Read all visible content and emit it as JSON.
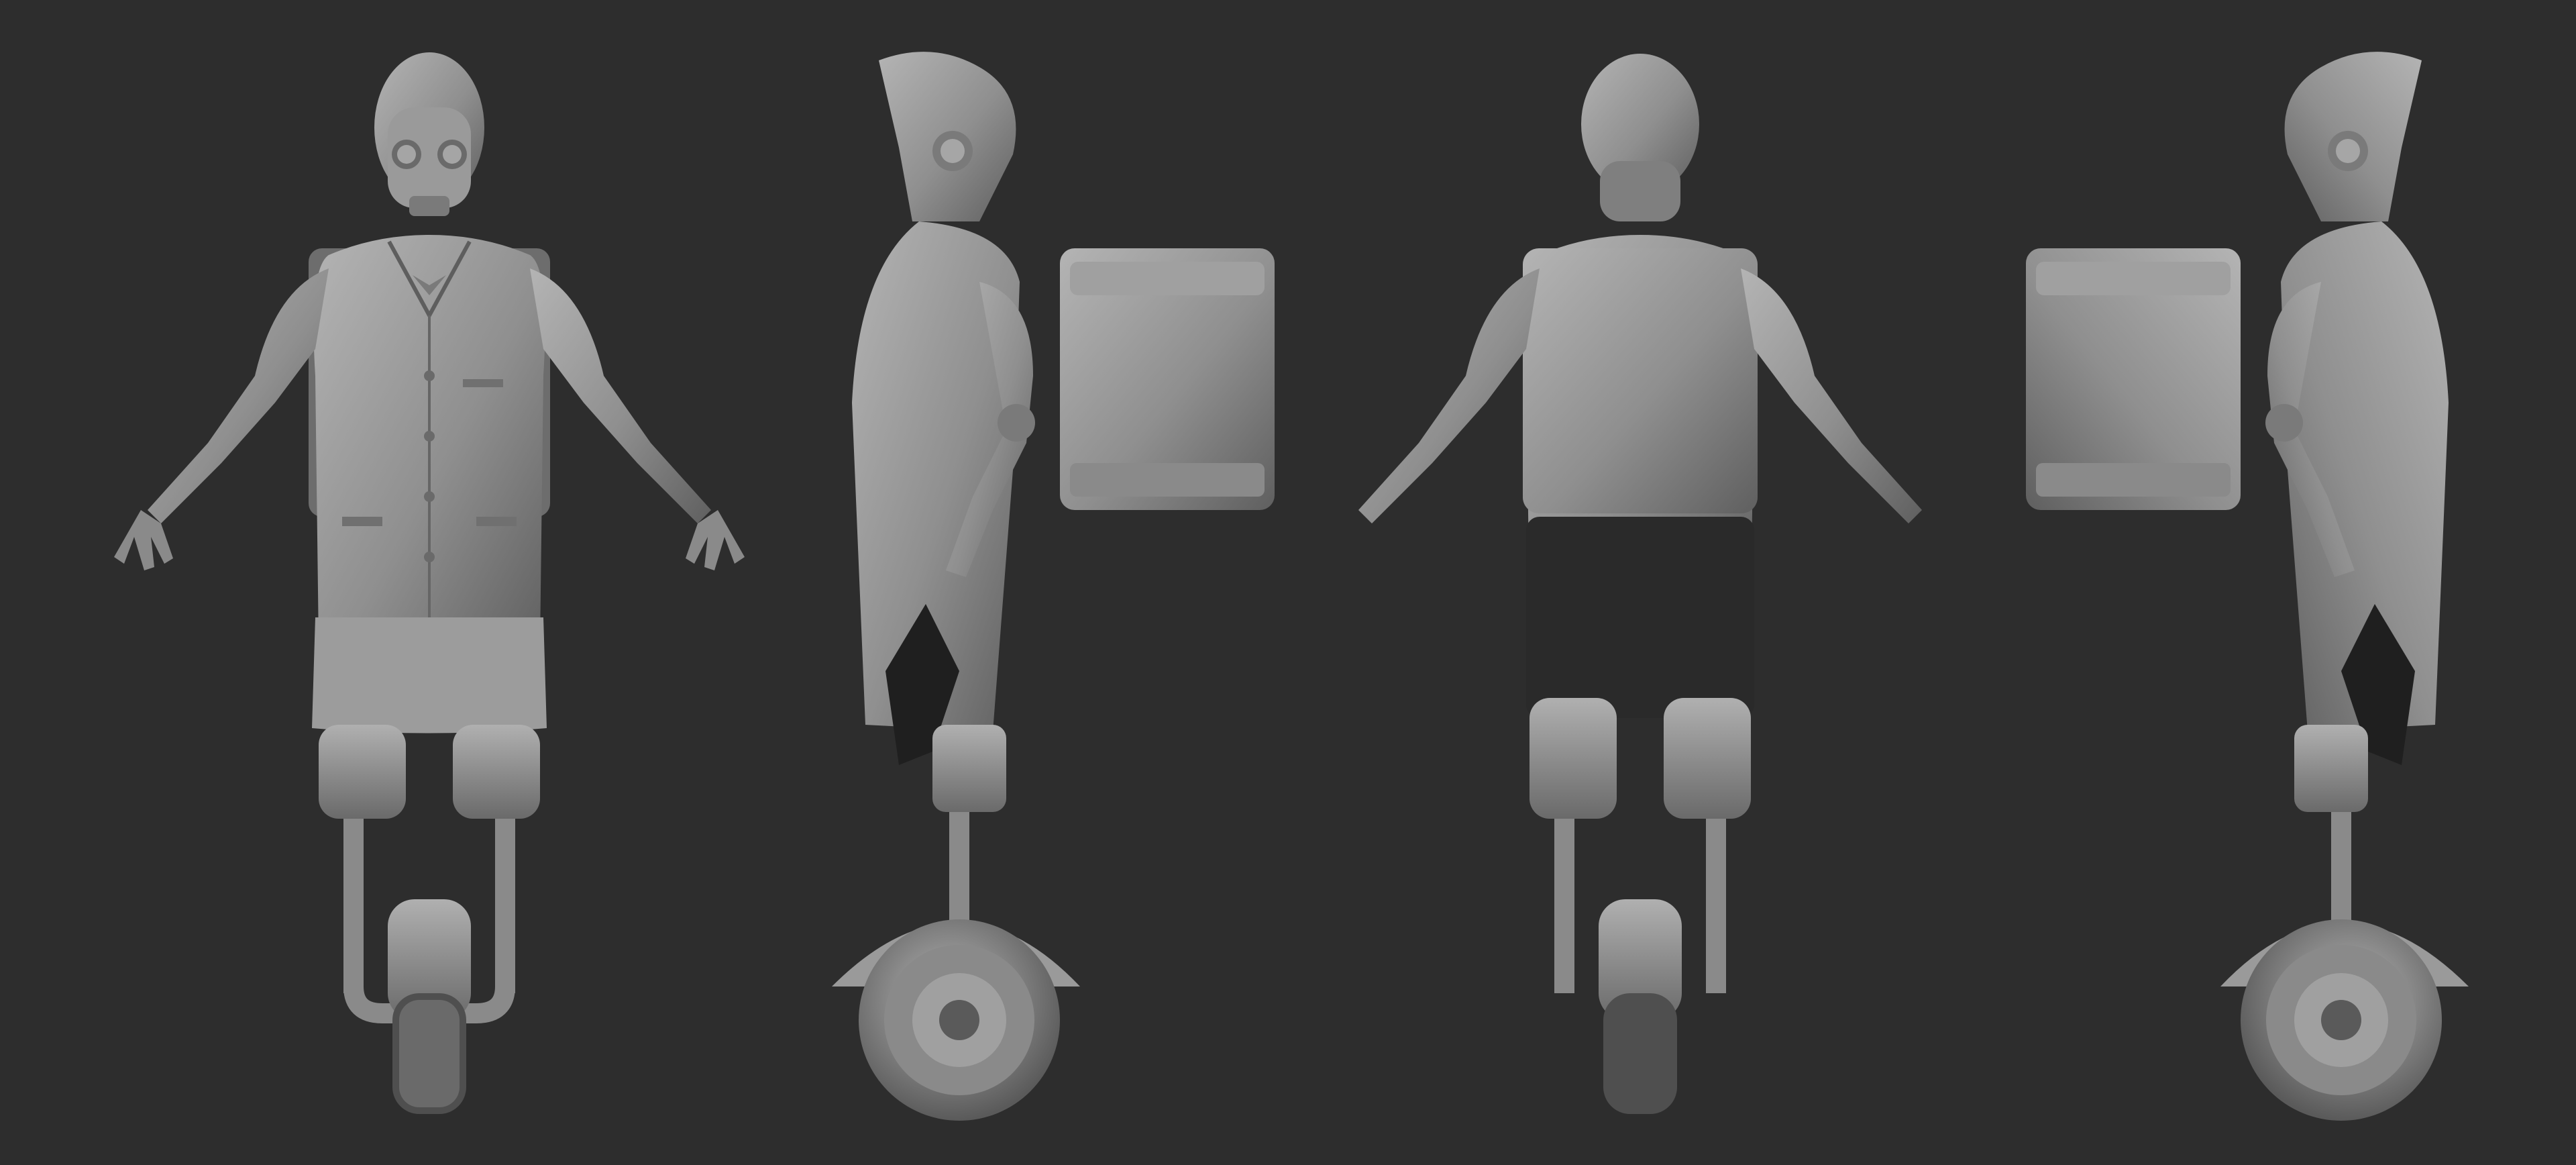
{
  "scene": {
    "background": "#2d2d2d",
    "description_free": true,
    "views": [
      {
        "id": "front",
        "name": "front-view"
      },
      {
        "id": "side-left",
        "name": "side-view-left"
      },
      {
        "id": "back",
        "name": "back-view"
      },
      {
        "id": "side-right",
        "name": "side-view-right"
      }
    ],
    "colors": {
      "clay_light": "#a9a9a9",
      "clay_mid": "#8a8a8a",
      "clay_dark": "#5e5e5e",
      "shadow": "#1f1f1f",
      "shorts": "#2a2a2a"
    }
  }
}
